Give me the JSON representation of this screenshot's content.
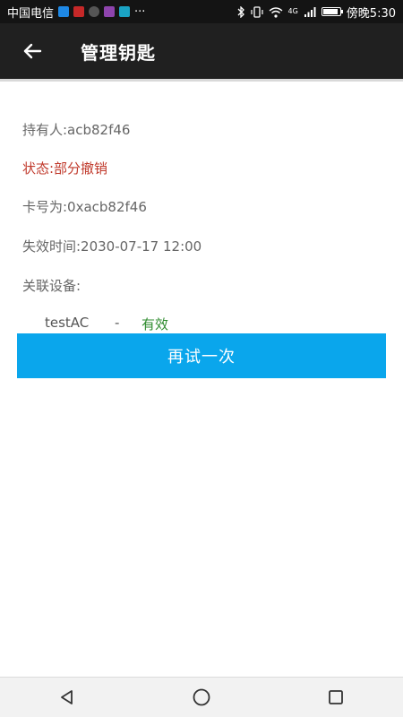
{
  "status_bar": {
    "carrier": "中国电信",
    "more": "···",
    "network": "4G",
    "time": "傍晚5:30",
    "battery_level": 0.9,
    "app_icon_colors": [
      "#1e88e5",
      "#c62828",
      "#555555",
      "#8e44ad",
      "#1aa3c4"
    ]
  },
  "header": {
    "title": "管理钥匙",
    "back_icon": "arrow-left-icon"
  },
  "key_info": {
    "holder": "持有人:acb82f46",
    "status": "状态:部分撤销",
    "card_number": "卡号为:0xacb82f46",
    "expiry": "失效时间:2030-07-17 12:00",
    "devices_label": "关联设备:"
  },
  "devices": [
    {
      "name": "testAC",
      "separator": "-",
      "status": "有效"
    }
  ],
  "retry_button": {
    "label": "再试一次"
  },
  "colors": {
    "status_red": "#c0392b",
    "valid_green": "#2e8b2e",
    "button_blue": "#0aa6ec",
    "header_bg": "#202020"
  },
  "nav": {
    "back": "triangle-back-icon",
    "home": "circle-home-icon",
    "recents": "square-recents-icon"
  }
}
